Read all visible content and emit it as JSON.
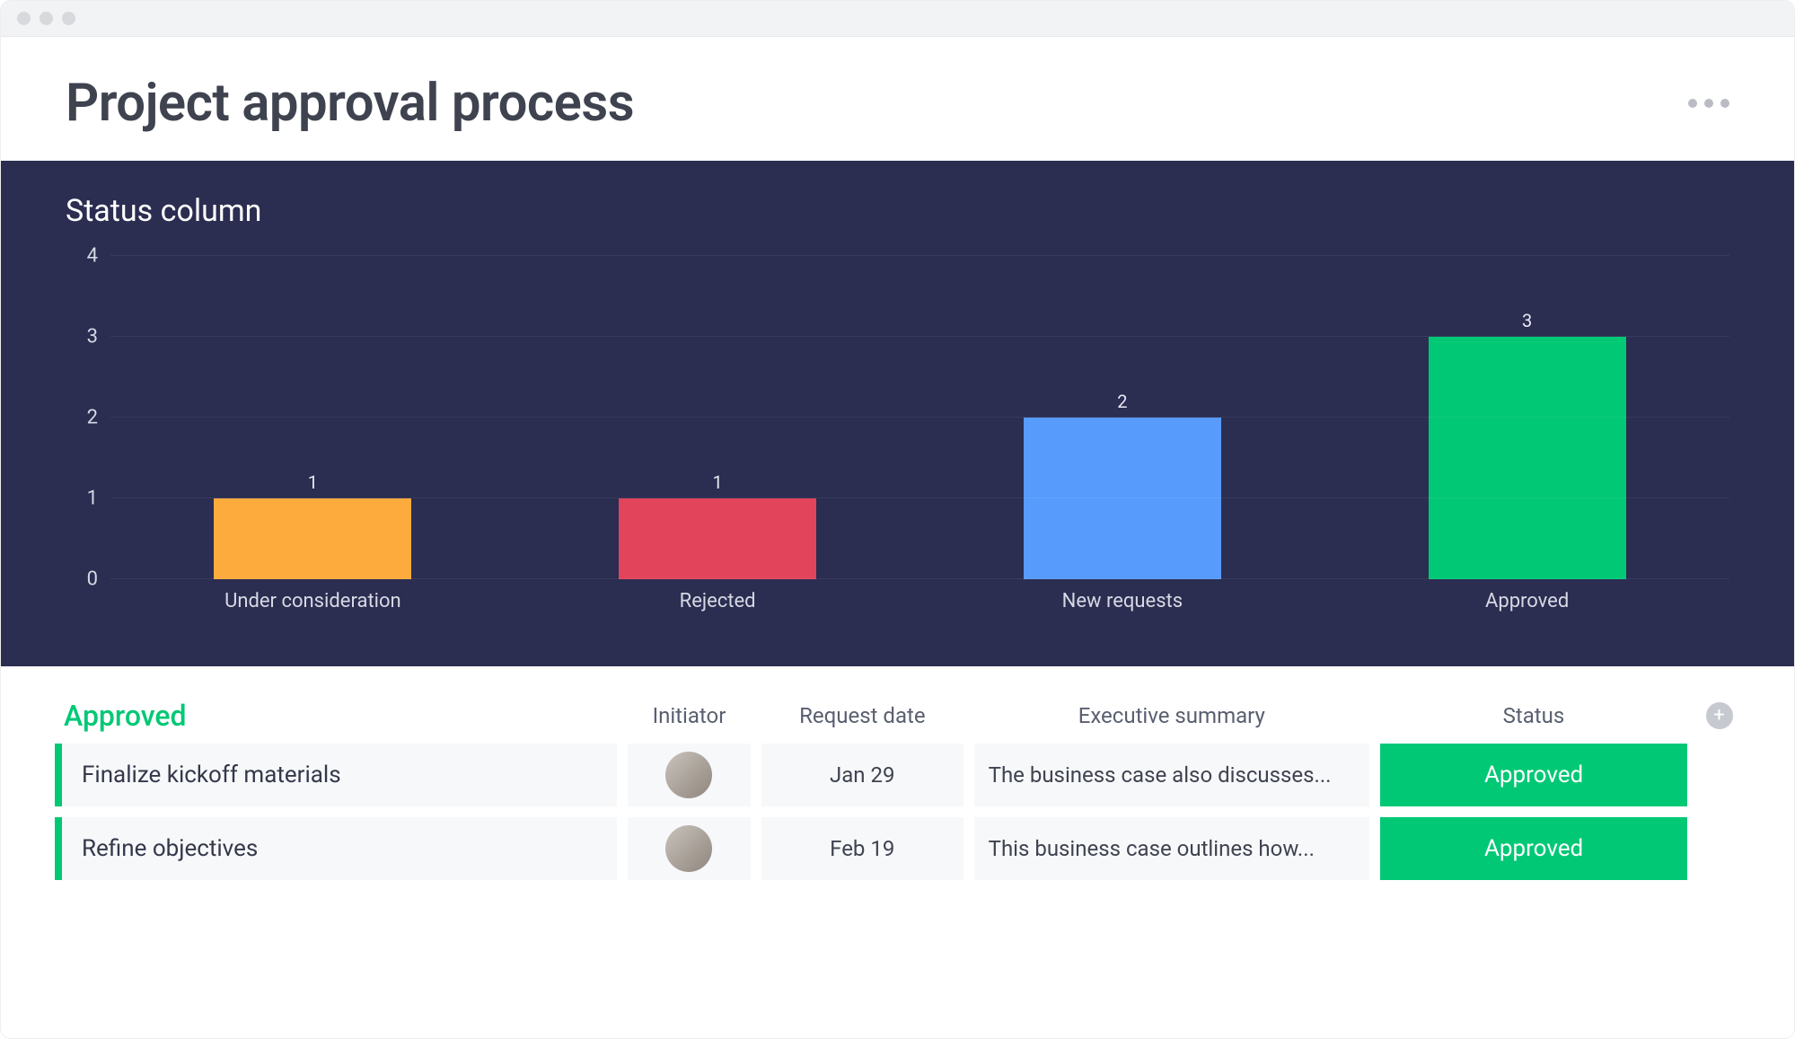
{
  "header": {
    "title": "Project approval process"
  },
  "chart": {
    "title": "Status column"
  },
  "chart_data": {
    "type": "bar",
    "categories": [
      "Under consideration",
      "Rejected",
      "New requests",
      "Approved"
    ],
    "values": [
      1,
      1,
      2,
      3
    ],
    "colors": [
      "#fdab3d",
      "#e2445c",
      "#579bfc",
      "#00c875"
    ],
    "title": "Status column",
    "xlabel": "",
    "ylabel": "",
    "ylim": [
      0,
      4
    ],
    "yticks": [
      0,
      1,
      2,
      3,
      4
    ]
  },
  "table": {
    "group_label": "Approved",
    "columns": {
      "initiator": "Initiator",
      "request_date": "Request date",
      "executive_summary": "Executive summary",
      "status": "Status"
    },
    "rows": [
      {
        "title": "Finalize kickoff materials",
        "request_date": "Jan 29",
        "executive_summary": "The business case also discusses...",
        "status": "Approved"
      },
      {
        "title": "Refine objectives",
        "request_date": "Feb 19",
        "executive_summary": "This business case outlines how...",
        "status": "Approved"
      }
    ]
  }
}
